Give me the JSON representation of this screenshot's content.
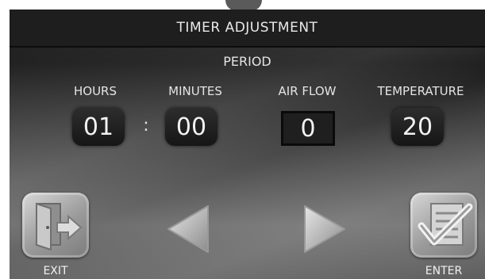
{
  "title": "TIMER ADJUSTMENT",
  "period_label": "PERIOD",
  "fields": {
    "hours": {
      "label": "HOURS",
      "value": "01"
    },
    "minutes": {
      "label": "MINUTES",
      "value": "00"
    },
    "air_flow": {
      "label": "AIR FLOW",
      "value": "0"
    },
    "temperature": {
      "label": "TEMPERATURE",
      "value": "20"
    }
  },
  "separator": ":",
  "buttons": {
    "exit": {
      "label": "EXIT",
      "icon": "exit-door-icon"
    },
    "previous": {
      "icon": "left-arrow-icon"
    },
    "next": {
      "icon": "right-arrow-icon"
    },
    "enter": {
      "label": "ENTER",
      "icon": "checklist-icon"
    }
  },
  "colors": {
    "title_bar": "#1e1e1e",
    "value_box": "#1f1f1f",
    "text": "#e9e9e9",
    "button_face": "#b0b0b0"
  }
}
